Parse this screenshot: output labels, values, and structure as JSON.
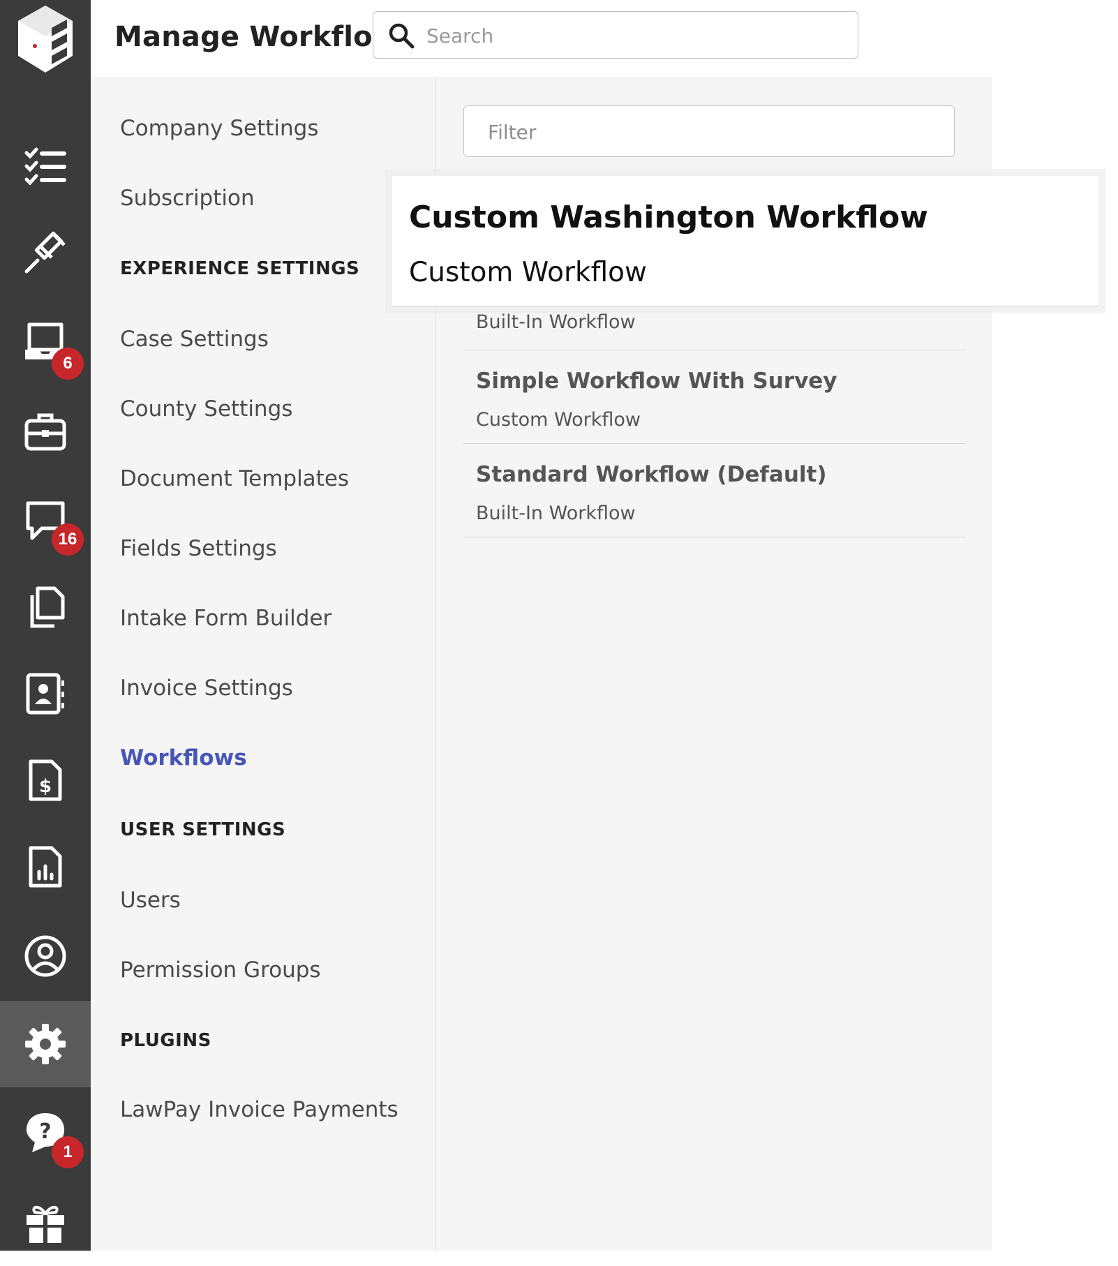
{
  "header": {
    "title": "Manage Workflows",
    "search_placeholder": "Search"
  },
  "rail": {
    "items": [
      {
        "icon": "tasks-icon"
      },
      {
        "icon": "gavel-icon"
      },
      {
        "icon": "inbox-icon",
        "badge": "6"
      },
      {
        "icon": "briefcase-icon"
      },
      {
        "icon": "chat-icon",
        "badge": "16"
      },
      {
        "icon": "documents-icon"
      },
      {
        "icon": "contacts-icon"
      },
      {
        "icon": "invoice-icon"
      },
      {
        "icon": "reports-icon"
      },
      {
        "icon": "profile-icon"
      },
      {
        "icon": "gear-icon",
        "active": true
      },
      {
        "icon": "help-icon",
        "badge": "1"
      },
      {
        "icon": "gift-icon"
      }
    ]
  },
  "settings_nav": {
    "company_settings": "Company Settings",
    "subscription": "Subscription",
    "section_experience": "EXPERIENCE SETTINGS",
    "case_settings": "Case Settings",
    "county_settings": "County Settings",
    "document_templates": "Document Templates",
    "fields_settings": "Fields Settings",
    "intake_form_builder": "Intake Form Builder",
    "invoice_settings": "Invoice Settings",
    "workflows": "Workflows",
    "section_user": "USER SETTINGS",
    "users": "Users",
    "permission_groups": "Permission Groups",
    "section_plugins": "PLUGINS",
    "lawpay": "LawPay Invoice Payments"
  },
  "main": {
    "filter_placeholder": "Filter",
    "workflows": [
      {
        "name": "",
        "type": "Built-In Workflow"
      },
      {
        "name": "Simple Workflow With Survey",
        "type": "Custom Workflow"
      },
      {
        "name": "Standard Workflow  (Default)",
        "type": "Built-In Workflow"
      }
    ],
    "dragged": {
      "name": "Custom Washington Workflow",
      "type": "Custom Workflow"
    }
  },
  "colors": {
    "rail_bg": "#3b3b3b",
    "badge": "#c7262a",
    "active_nav": "#4856b8"
  }
}
